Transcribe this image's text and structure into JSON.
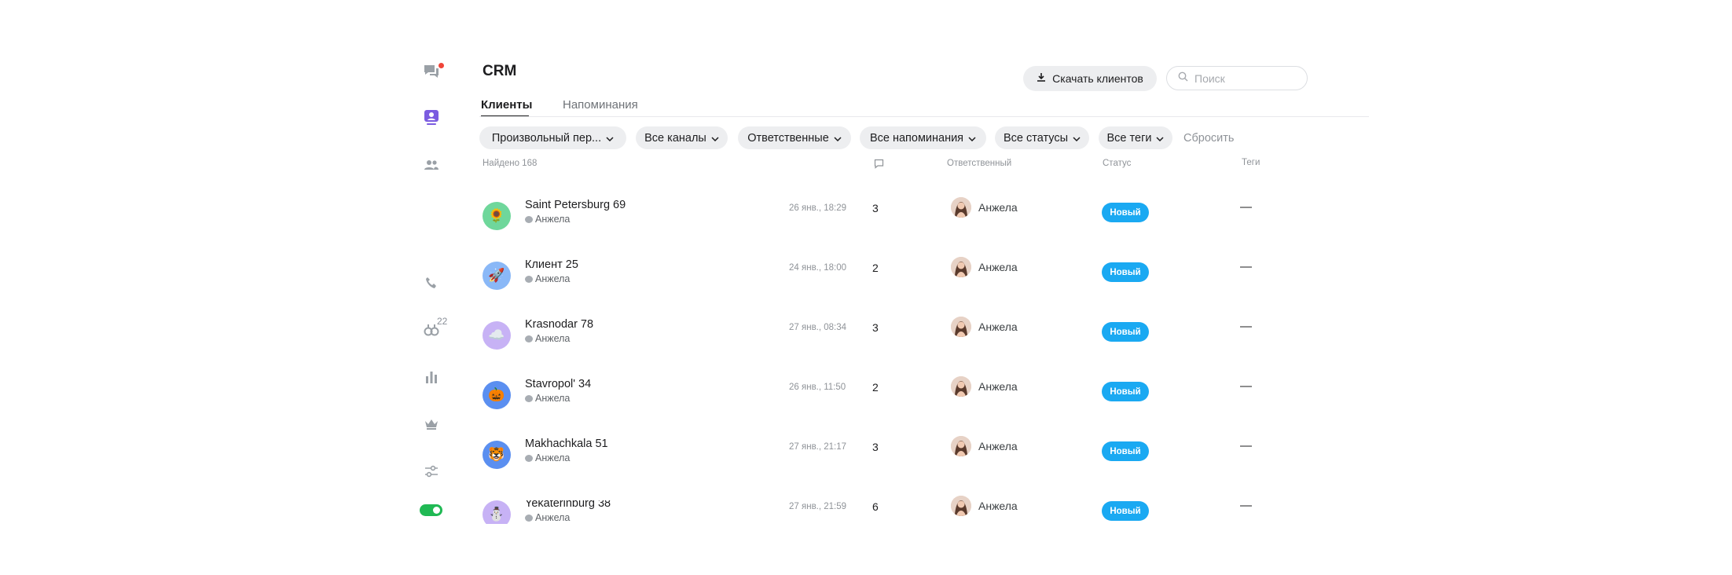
{
  "rail": {
    "messages_icon": "chat-bubbles-icon",
    "clients_icon": "contact-card-icon",
    "team_icon": "people-icon",
    "phone_icon": "phone-icon",
    "bots_icon": "bots-icon",
    "bots_badge": "22",
    "stats_icon": "bar-chart-icon",
    "crown_icon": "crown-icon",
    "settings_icon": "sliders-icon",
    "toggle_state": "on"
  },
  "header": {
    "title": "CRM",
    "tabs": [
      {
        "label": "Клиенты",
        "active": true
      },
      {
        "label": "Напоминания",
        "active": false
      }
    ],
    "download_label": "Скачать клиентов",
    "search_placeholder": "Поиск"
  },
  "filters": [
    {
      "label": "Произвольный пер..."
    },
    {
      "label": "Все каналы"
    },
    {
      "label": "Ответственные"
    },
    {
      "label": "Все напоминания"
    },
    {
      "label": "Все статусы"
    },
    {
      "label": "Все теги"
    }
  ],
  "reset_label": "Сбросить",
  "table": {
    "found": "Найдено 168",
    "col_responsible": "Ответственный",
    "col_status": "Статус",
    "col_tags": "Теги",
    "rows": [
      {
        "name": "Saint Petersburg 69",
        "owner": "Анжела",
        "date": "26 янв., 18:29",
        "count": "3",
        "responsible": "Анжела",
        "status": "Новый",
        "tags": "—",
        "avatar_emoji": "🌻",
        "avatar_bg": "#6fd79b"
      },
      {
        "name": "Клиент 25",
        "owner": "Анжела",
        "date": "24 янв., 18:00",
        "count": "2",
        "responsible": "Анжела",
        "status": "Новый",
        "tags": "—",
        "avatar_emoji": "🚀",
        "avatar_bg": "#8ab8f7"
      },
      {
        "name": "Krasnodar 78",
        "owner": "Анжела",
        "date": "27 янв., 08:34",
        "count": "3",
        "responsible": "Анжела",
        "status": "Новый",
        "tags": "—",
        "avatar_emoji": "☁️",
        "avatar_bg": "#c7b2f5"
      },
      {
        "name": "Stavropol' 34",
        "owner": "Анжела",
        "date": "26 янв., 11:50",
        "count": "2",
        "responsible": "Анжела",
        "status": "Новый",
        "tags": "—",
        "avatar_emoji": "🎃",
        "avatar_bg": "#5b8ff0"
      },
      {
        "name": "Makhachkala 51",
        "owner": "Анжела",
        "date": "27 янв., 21:17",
        "count": "3",
        "responsible": "Анжела",
        "status": "Новый",
        "tags": "—",
        "avatar_emoji": "🐯",
        "avatar_bg": "#5b8ff0"
      },
      {
        "name": "Yekaterinburg 38",
        "owner": "Анжела",
        "date": "27 янв., 21:59",
        "count": "6",
        "responsible": "Анжела",
        "status": "Новый",
        "tags": "—",
        "avatar_emoji": "⛄",
        "avatar_bg": "#c7b2f5"
      }
    ]
  },
  "colors": {
    "status_new": "#1aa9f2",
    "rail_active": "#7b5ce0",
    "toggle_on": "#20b954",
    "notification_dot": "#f04438"
  }
}
